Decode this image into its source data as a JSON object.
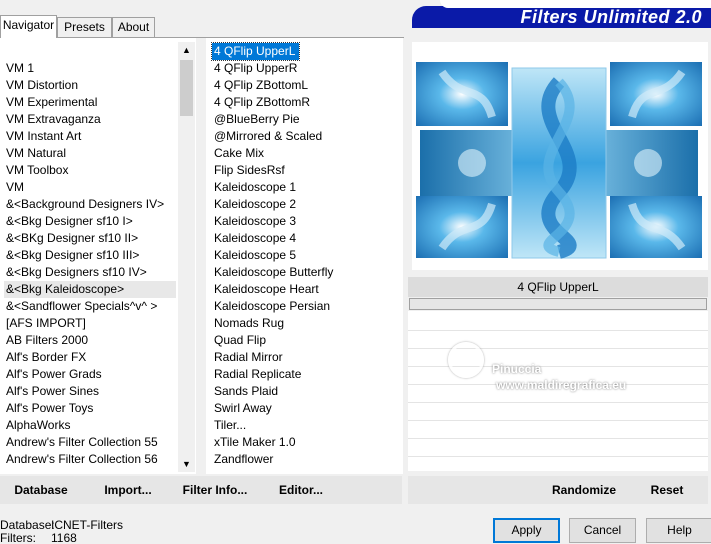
{
  "tabs": [
    "Navigator",
    "Presets",
    "About"
  ],
  "header": {
    "title": "Filters Unlimited 2.0"
  },
  "categories": [
    "VM 1",
    "VM Distortion",
    "VM Experimental",
    "VM Extravaganza",
    "VM Instant Art",
    "VM Natural",
    "VM Toolbox",
    "VM",
    "&<Background Designers IV>",
    "&<Bkg Designer sf10 I>",
    "&<BKg Designer sf10 II>",
    "&<Bkg Designer sf10 III>",
    "&<Bkg Designers sf10 IV>",
    "&<Bkg Kaleidoscope>",
    "&<Sandflower Specials^v^ >",
    "[AFS IMPORT]",
    "AB Filters 2000",
    "Alf's Border FX",
    "Alf's Power Grads",
    "Alf's Power Sines",
    "Alf's Power Toys",
    "AlphaWorks",
    "Andrew's Filter Collection 55",
    "Andrew's Filter Collection 56"
  ],
  "selected_category_index": 13,
  "filters": [
    "4 QFlip UpperL",
    "4 QFlip UpperR",
    "4 QFlip ZBottomL",
    "4 QFlip ZBottomR",
    "@BlueBerry Pie",
    "@Mirrored & Scaled",
    "Cake Mix",
    "Flip SidesRsf",
    "Kaleidoscope 1",
    "Kaleidoscope 2",
    "Kaleidoscope 3",
    "Kaleidoscope 4",
    "Kaleidoscope 5",
    "Kaleidoscope Butterfly",
    "Kaleidoscope Heart",
    "Kaleidoscope Persian",
    "Nomads Rug",
    "Quad Flip",
    "Radial Mirror",
    "Radial Replicate",
    "Sands Plaid",
    "Swirl Away",
    "Tiler...",
    "xTile Maker 1.0",
    "Zandflower"
  ],
  "selected_filter_index": 0,
  "preview": {
    "filter_name": "4 QFlip UpperL"
  },
  "watermark": {
    "line1": "Pinuccia",
    "line2": "www.maldiregrafica.eu"
  },
  "toolbar": {
    "database": "Database",
    "import": "Import...",
    "filter_info": "Filter Info...",
    "editor": "Editor...",
    "randomize": "Randomize",
    "reset": "Reset"
  },
  "status": {
    "database_label": "Database:",
    "database_value": "ICNET-Filters",
    "filters_label": "Filters:",
    "filters_value": "1168"
  },
  "buttons": {
    "apply": "Apply",
    "cancel": "Cancel",
    "help": "Help"
  },
  "colors": {
    "selection": "#0078d7",
    "logo_bar": "#0a1aa8",
    "preview_blue": "#2a8fd6"
  },
  "icons": {
    "scroll_up": "▲",
    "scroll_down": "▼"
  }
}
